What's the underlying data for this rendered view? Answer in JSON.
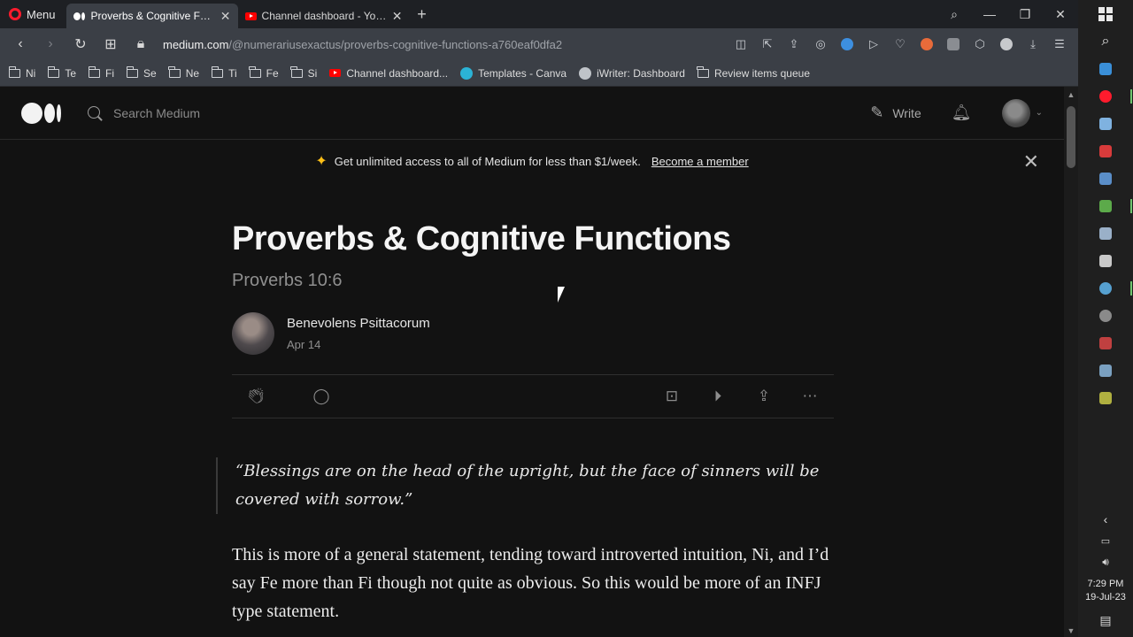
{
  "browser": {
    "menu_label": "Menu",
    "tabs": [
      {
        "label": "Proverbs & Cognitive Func",
        "active": true
      },
      {
        "label": "Channel dashboard - YouTu",
        "active": false
      }
    ],
    "url_host": "medium.com",
    "url_path": "/@numerariusexactus/proverbs-cognitive-functions-a760eaf0dfa2",
    "bookmarks": [
      {
        "label": "Ni",
        "type": "folder"
      },
      {
        "label": "Te",
        "type": "folder"
      },
      {
        "label": "Fi",
        "type": "folder"
      },
      {
        "label": "Se",
        "type": "folder"
      },
      {
        "label": "Ne",
        "type": "folder"
      },
      {
        "label": "Ti",
        "type": "folder"
      },
      {
        "label": "Fe",
        "type": "folder"
      },
      {
        "label": "Si",
        "type": "folder"
      },
      {
        "label": "Channel dashboard...",
        "type": "youtube"
      },
      {
        "label": "Templates - Canva",
        "type": "canva"
      },
      {
        "label": "iWriter: Dashboard",
        "type": "iwriter"
      },
      {
        "label": "Review items queue",
        "type": "folder"
      }
    ]
  },
  "medium": {
    "search_placeholder": "Search Medium",
    "write_label": "Write",
    "banner_text": "Get unlimited access to all of Medium for less than $1/week.",
    "banner_link": "Become a member"
  },
  "article": {
    "title": "Proverbs & Cognitive Functions",
    "subtitle": "Proverbs 10:6",
    "author": "Benevolens Psittacorum",
    "date": "Apr 14",
    "quote": "“Blessings are on the head of the upright, but the face of sinners will be covered with sorrow.”",
    "paragraph": "This is more of a general statement, tending toward introverted intuition, Ni, and I’d say Fe more than Fi though not quite as obvious. So this would be more of an INFJ type statement."
  },
  "taskbar": {
    "time": "7:29 PM",
    "date": "19-Jul-23"
  },
  "colors": {
    "accent_star": "#ffc017",
    "opera_red": "#ff1b2d",
    "youtube_red": "#ff0000"
  }
}
